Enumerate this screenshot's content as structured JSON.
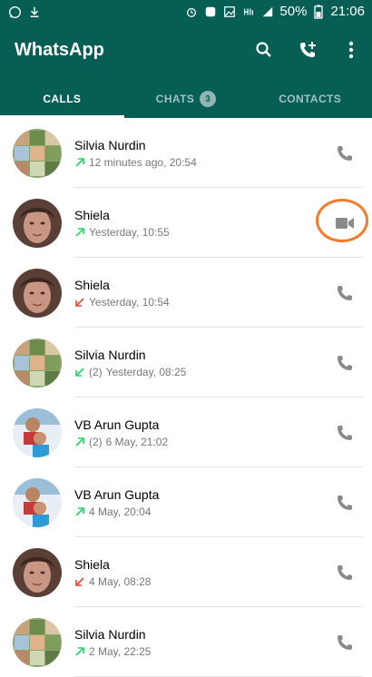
{
  "status_bar": {
    "battery": "50%",
    "time": "21:06"
  },
  "app_bar": {
    "title": "WhatsApp"
  },
  "tabs": [
    {
      "label": "CALLS",
      "active": true
    },
    {
      "label": "CHATS",
      "badge": "3",
      "active": false
    },
    {
      "label": "CONTACTS",
      "active": false
    }
  ],
  "calls": [
    {
      "name": "Silvia Nurdin",
      "direction": "outgoing",
      "count": "",
      "time": "12 minutes ago, 20:54",
      "type": "voice",
      "avatar": "collage"
    },
    {
      "name": "Shiela",
      "direction": "outgoing",
      "count": "",
      "time": "Yesterday, 10:55",
      "type": "video",
      "avatar": "portrait"
    },
    {
      "name": "Shiela",
      "direction": "missed",
      "count": "",
      "time": "Yesterday, 10:54",
      "type": "voice",
      "avatar": "portrait"
    },
    {
      "name": "Silvia Nurdin",
      "direction": "incoming",
      "count": "(2)",
      "time": "Yesterday, 08:25",
      "type": "voice",
      "avatar": "collage"
    },
    {
      "name": "VB Arun Gupta",
      "direction": "outgoing",
      "count": "(2)",
      "time": "6 May, 21:02",
      "type": "voice",
      "avatar": "family"
    },
    {
      "name": "VB Arun Gupta",
      "direction": "outgoing",
      "count": "",
      "time": "4 May, 20:04",
      "type": "voice",
      "avatar": "family"
    },
    {
      "name": "Shiela",
      "direction": "missed",
      "count": "",
      "time": "4 May, 08:28",
      "type": "voice",
      "avatar": "portrait"
    },
    {
      "name": "Silvia Nurdin",
      "direction": "outgoing",
      "count": "",
      "time": "2 May, 22:25",
      "type": "voice",
      "avatar": "collage"
    }
  ],
  "colors": {
    "primary": "#075e54",
    "outgoing_arrow": "#25d366",
    "missed_arrow": "#f44336",
    "highlight": "#f47a2b"
  }
}
